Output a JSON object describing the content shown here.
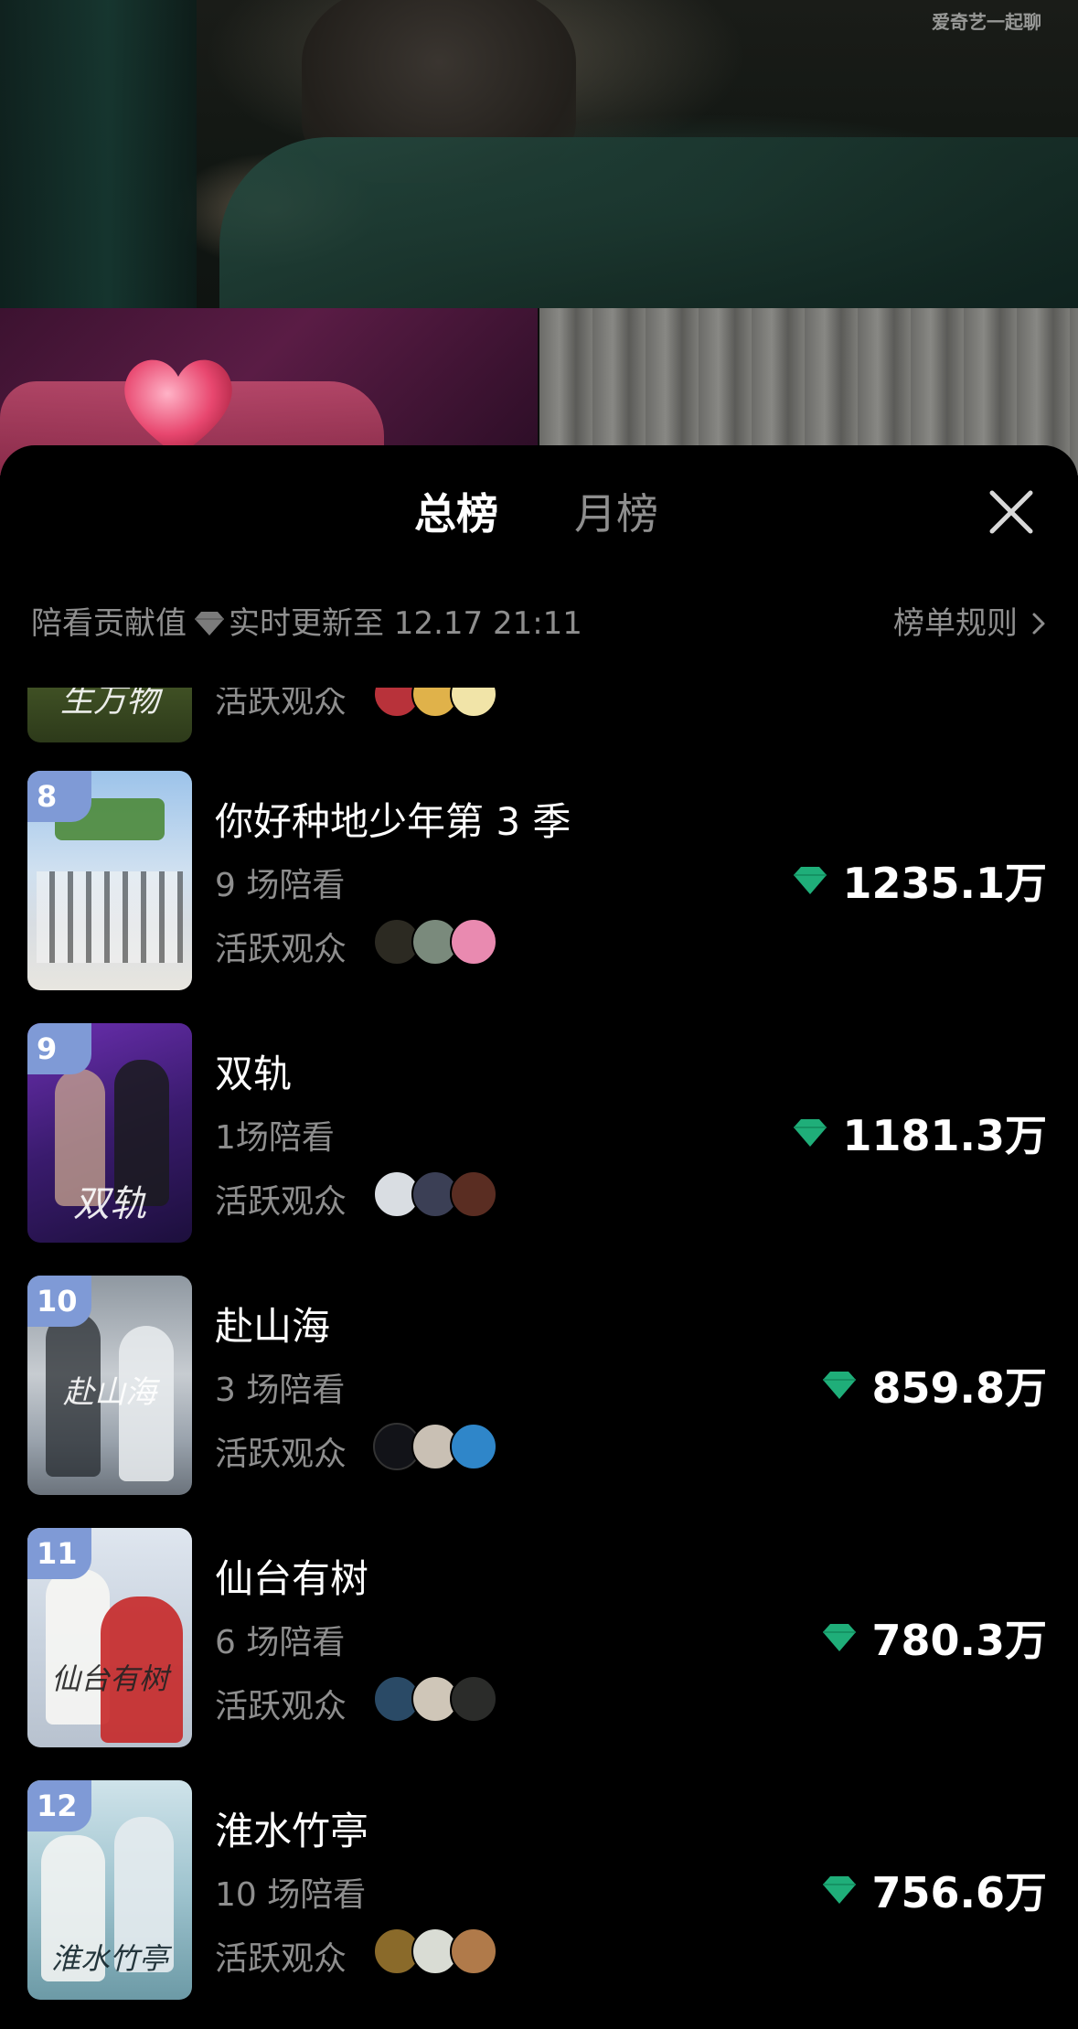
{
  "video": {
    "watermark": "爱奇艺一起聊"
  },
  "sheet": {
    "tabs": [
      {
        "label": "总榜",
        "active": true
      },
      {
        "label": "月榜",
        "active": false
      }
    ],
    "info": {
      "label": "陪看贡献值",
      "update_text": "实时更新至 12.17 21:11",
      "rules_label": "榜单规则"
    },
    "active_audience_label": "活跃观众",
    "partial_row": {
      "poster_title": "生万物"
    },
    "rows": [
      {
        "rank": "8",
        "title": "你好种地少年第 3 季",
        "sessions": "9 场陪看",
        "score": "1235.1万",
        "poster_title": "",
        "avatar_colors": [
          "#2c2a22",
          "#7a8a7c",
          "#e98ab0"
        ]
      },
      {
        "rank": "9",
        "title": "双轨",
        "sessions": "1场陪看",
        "score": "1181.3万",
        "poster_title": "双轨",
        "avatar_colors": [
          "#d9dde2",
          "#3b3f55",
          "#5a2d22"
        ]
      },
      {
        "rank": "10",
        "title": "赴山海",
        "sessions": "3 场陪看",
        "score": "859.8万",
        "poster_title": "赴山海",
        "avatar_colors": [
          "#121318",
          "#c9c0b4",
          "#2f86c9"
        ]
      },
      {
        "rank": "11",
        "title": "仙台有树",
        "sessions": "6 场陪看",
        "score": "780.3万",
        "poster_title": "仙台有树",
        "avatar_colors": [
          "#2a4a66",
          "#cfc6b8",
          "#2b2c2a"
        ]
      },
      {
        "rank": "12",
        "title": "淮水竹亭",
        "sessions": "10 场陪看",
        "score": "756.6万",
        "poster_title": "淮水竹亭",
        "avatar_colors": [
          "#8a6a2a",
          "#d9dcd4",
          "#b07a4a"
        ]
      }
    ]
  },
  "colors": {
    "accent_gem": "#1fae79",
    "rank_badge": "#7f9ad6",
    "muted_text": "#8e8e8e"
  },
  "icons": {
    "close": "close-icon",
    "gem": "diamond-icon",
    "chevron": "chevron-right-icon"
  }
}
